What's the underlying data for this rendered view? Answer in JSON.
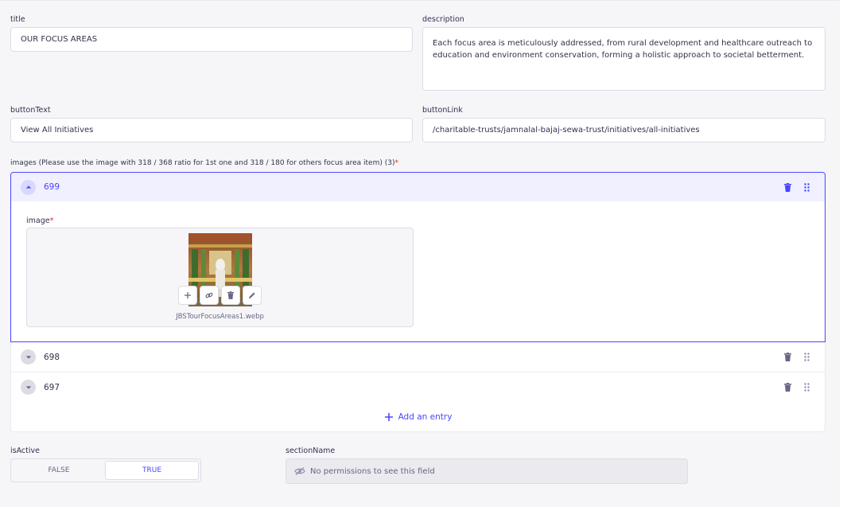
{
  "fields": {
    "title": {
      "label": "title",
      "value": "OUR FOCUS AREAS"
    },
    "description": {
      "label": "description",
      "value": "Each focus area is meticulously addressed, from rural development and healthcare outreach to education and environment conservation, forming a holistic approach to societal betterment."
    },
    "buttonText": {
      "label": "buttonText",
      "value": "View All Initiatives"
    },
    "buttonLink": {
      "label": "buttonLink",
      "value": "/charitable-trusts/jamnalal-bajaj-sewa-trust/initiatives/all-initiatives"
    }
  },
  "images": {
    "label": "images (Please use the image with 318 / 368 ratio for 1st one and 318 / 180 for others focus area item) (3)",
    "required_mark": "*",
    "entries": [
      {
        "title": "699",
        "expanded": true
      },
      {
        "title": "698",
        "expanded": false
      },
      {
        "title": "697",
        "expanded": false
      }
    ],
    "image_field": {
      "label": "image",
      "required_mark": "*",
      "file_name": "JBSTourFocusAreas1.webp"
    },
    "add_entry_label": "Add an entry"
  },
  "isActive": {
    "label": "isActive",
    "options": [
      "FALSE",
      "TRUE"
    ],
    "selected": "TRUE"
  },
  "sectionName": {
    "label": "sectionName",
    "message": "No permissions to see this field"
  },
  "colors": {
    "primary": "#4945ff",
    "required": "#d02b20",
    "panel_bg": "#f6f6f9"
  }
}
